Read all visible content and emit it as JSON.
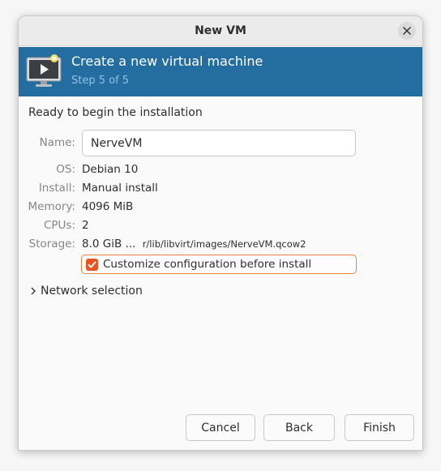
{
  "window": {
    "title": "New VM"
  },
  "banner": {
    "heading": "Create a new virtual machine",
    "step": "Step 5 of 5"
  },
  "summary": {
    "intro": "Ready to begin the installation",
    "name_label": "Name:",
    "name_value": "NerveVM",
    "os_label": "OS:",
    "os_value": "Debian 10",
    "install_label": "Install:",
    "install_value": "Manual install",
    "memory_label": "Memory:",
    "memory_value": "4096 MiB",
    "cpus_label": "CPUs:",
    "cpus_value": "2",
    "storage_label": "Storage:",
    "storage_size": "8.0 GiB ...",
    "storage_path": "r/lib/libvirt/images/NerveVM.qcow2"
  },
  "customize": {
    "label": "Customize configuration before install",
    "checked": true
  },
  "network": {
    "label": "Network selection"
  },
  "buttons": {
    "cancel": "Cancel",
    "back": "Back",
    "finish": "Finish"
  },
  "colors": {
    "banner": "#236da1",
    "accent": "#e95420",
    "focus_border": "#e9823f"
  }
}
